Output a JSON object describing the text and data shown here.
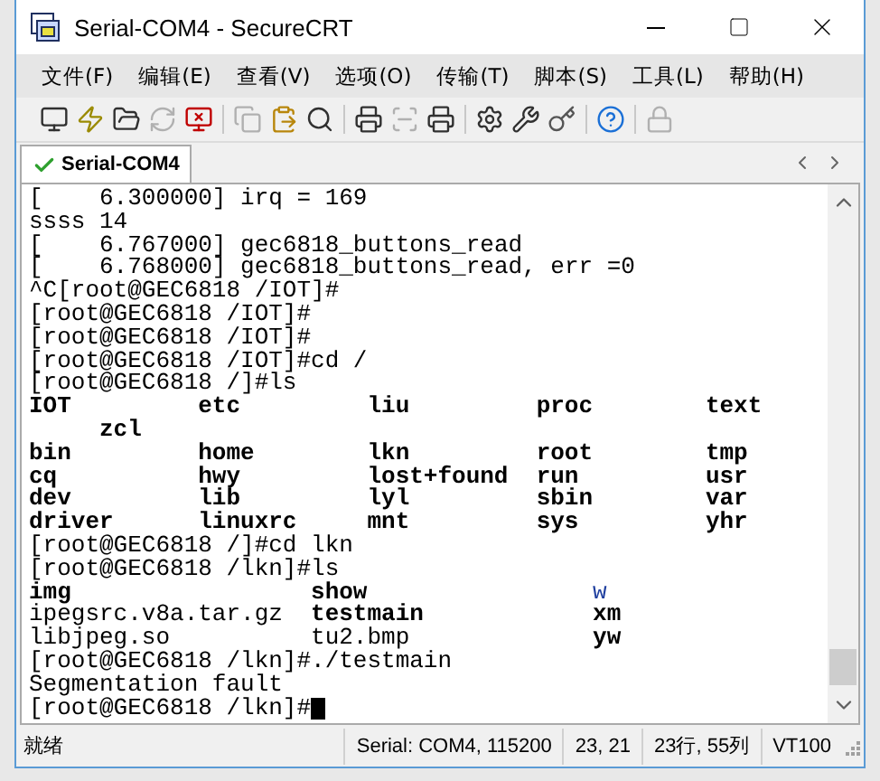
{
  "window": {
    "title": "Serial-COM4 - SecureCRT"
  },
  "menu": [
    "文件(F)",
    "编辑(E)",
    "查看(V)",
    "选项(O)",
    "传输(T)",
    "脚本(S)",
    "工具(L)",
    "帮助(H)"
  ],
  "toolbar": [
    [
      {
        "kind": "new",
        "disabled": false
      },
      {
        "kind": "quick",
        "disabled": false
      },
      {
        "kind": "folder",
        "disabled": false
      },
      {
        "kind": "reconnect",
        "disabled": true
      },
      {
        "kind": "disconnect",
        "disabled": false
      }
    ],
    [
      {
        "kind": "copy",
        "disabled": true
      },
      {
        "kind": "paste",
        "disabled": false
      },
      {
        "kind": "find",
        "disabled": false
      }
    ],
    [
      {
        "kind": "printsetup",
        "disabled": false
      },
      {
        "kind": "printsel",
        "disabled": true
      },
      {
        "kind": "print",
        "disabled": false
      }
    ],
    [
      {
        "kind": "options",
        "disabled": false
      },
      {
        "kind": "tools",
        "disabled": false
      },
      {
        "kind": "key",
        "disabled": false
      }
    ],
    [
      {
        "kind": "help",
        "disabled": false
      }
    ],
    [
      {
        "kind": "lock",
        "disabled": true
      }
    ]
  ],
  "tabs": [
    {
      "label": "Serial-COM4",
      "selected": true,
      "connected": true
    }
  ],
  "terminal": [
    {
      "kind": "text",
      "text": "[    6.300000] irq = 169",
      "cursor": false
    },
    {
      "kind": "text",
      "text": "ssss 14",
      "cursor": false
    },
    {
      "kind": "text",
      "text": "[    6.767000] gec6818_buttons_read",
      "cursor": false
    },
    {
      "kind": "text",
      "text": "[    6.768000] gec6818_buttons_read, err =0",
      "cursor": false
    },
    {
      "kind": "text",
      "text": "^C[root@GEC6818 /IOT]#",
      "cursor": false
    },
    {
      "kind": "text",
      "text": "[root@GEC6818 /IOT]#",
      "cursor": false
    },
    {
      "kind": "text",
      "text": "[root@GEC6818 /IOT]#",
      "cursor": false
    },
    {
      "kind": "text",
      "text": "[root@GEC6818 /IOT]#cd /",
      "cursor": false
    },
    {
      "kind": "text",
      "text": "[root@GEC6818 /]#ls",
      "cursor": false
    },
    {
      "kind": "listing",
      "rows": [
        {
          "wrapped": false,
          "cells": [
            {
              "text": "IOT",
              "kind": "directory"
            },
            {
              "text": "etc",
              "kind": "directory"
            },
            {
              "text": "liu",
              "kind": "directory"
            },
            {
              "text": "proc",
              "kind": "directory"
            },
            {
              "text": "text",
              "kind": "directory"
            }
          ]
        },
        {
          "wrapped": true,
          "cells": [
            {
              "text": "zcl",
              "kind": "directory"
            }
          ]
        },
        {
          "wrapped": false,
          "cells": [
            {
              "text": "bin",
              "kind": "directory"
            },
            {
              "text": "home",
              "kind": "directory"
            },
            {
              "text": "lkn",
              "kind": "directory"
            },
            {
              "text": "root",
              "kind": "directory"
            },
            {
              "text": "tmp",
              "kind": "directory"
            }
          ]
        },
        {
          "wrapped": false,
          "cells": [
            {
              "text": "cq",
              "kind": "directory"
            },
            {
              "text": "hwy",
              "kind": "directory"
            },
            {
              "text": "lost+found",
              "kind": "directory"
            },
            {
              "text": "run",
              "kind": "directory"
            },
            {
              "text": "usr",
              "kind": "directory"
            }
          ]
        },
        {
          "wrapped": false,
          "cells": [
            {
              "text": "dev",
              "kind": "directory"
            },
            {
              "text": "lib",
              "kind": "directory"
            },
            {
              "text": "lyl",
              "kind": "directory"
            },
            {
              "text": "sbin",
              "kind": "directory"
            },
            {
              "text": "var",
              "kind": "directory"
            }
          ]
        },
        {
          "wrapped": false,
          "cells": [
            {
              "text": "driver",
              "kind": "directory"
            },
            {
              "text": "linuxrc",
              "kind": "directory"
            },
            {
              "text": "mnt",
              "kind": "directory"
            },
            {
              "text": "sys",
              "kind": "directory"
            },
            {
              "text": "yhr",
              "kind": "directory"
            }
          ]
        }
      ]
    },
    {
      "kind": "text",
      "text": "[root@GEC6818 /]#cd lkn",
      "cursor": false
    },
    {
      "kind": "text",
      "text": "[root@GEC6818 /lkn]#ls",
      "cursor": false
    },
    {
      "kind": "listing",
      "rows": [
        {
          "wrapped": false,
          "cells": [
            {
              "text": "img",
              "kind": "directory"
            },
            {
              "text": "show",
              "kind": "directory"
            },
            {
              "text": "w",
              "kind": "link"
            }
          ]
        },
        {
          "wrapped": false,
          "cells": [
            {
              "text": "ipegsrc.v8a.tar.gz",
              "kind": "file"
            },
            {
              "text": "testmain",
              "kind": "directory"
            },
            {
              "text": "xm",
              "kind": "directory"
            }
          ]
        },
        {
          "wrapped": false,
          "cells": [
            {
              "text": "libjpeg.so",
              "kind": "file"
            },
            {
              "text": "tu2.bmp",
              "kind": "file"
            },
            {
              "text": "yw",
              "kind": "directory"
            }
          ]
        }
      ]
    },
    {
      "kind": "text",
      "text": "[root@GEC6818 /lkn]#./testmain",
      "cursor": false
    },
    {
      "kind": "text",
      "text": "Segmentation fault",
      "cursor": false
    },
    {
      "kind": "text",
      "text": "[root@GEC6818 /lkn]#",
      "cursor": true
    }
  ],
  "status_bar": [
    "就绪",
    "Serial: COM4, 115200",
    "23,  21",
    "23行, 55列",
    "VT100"
  ]
}
